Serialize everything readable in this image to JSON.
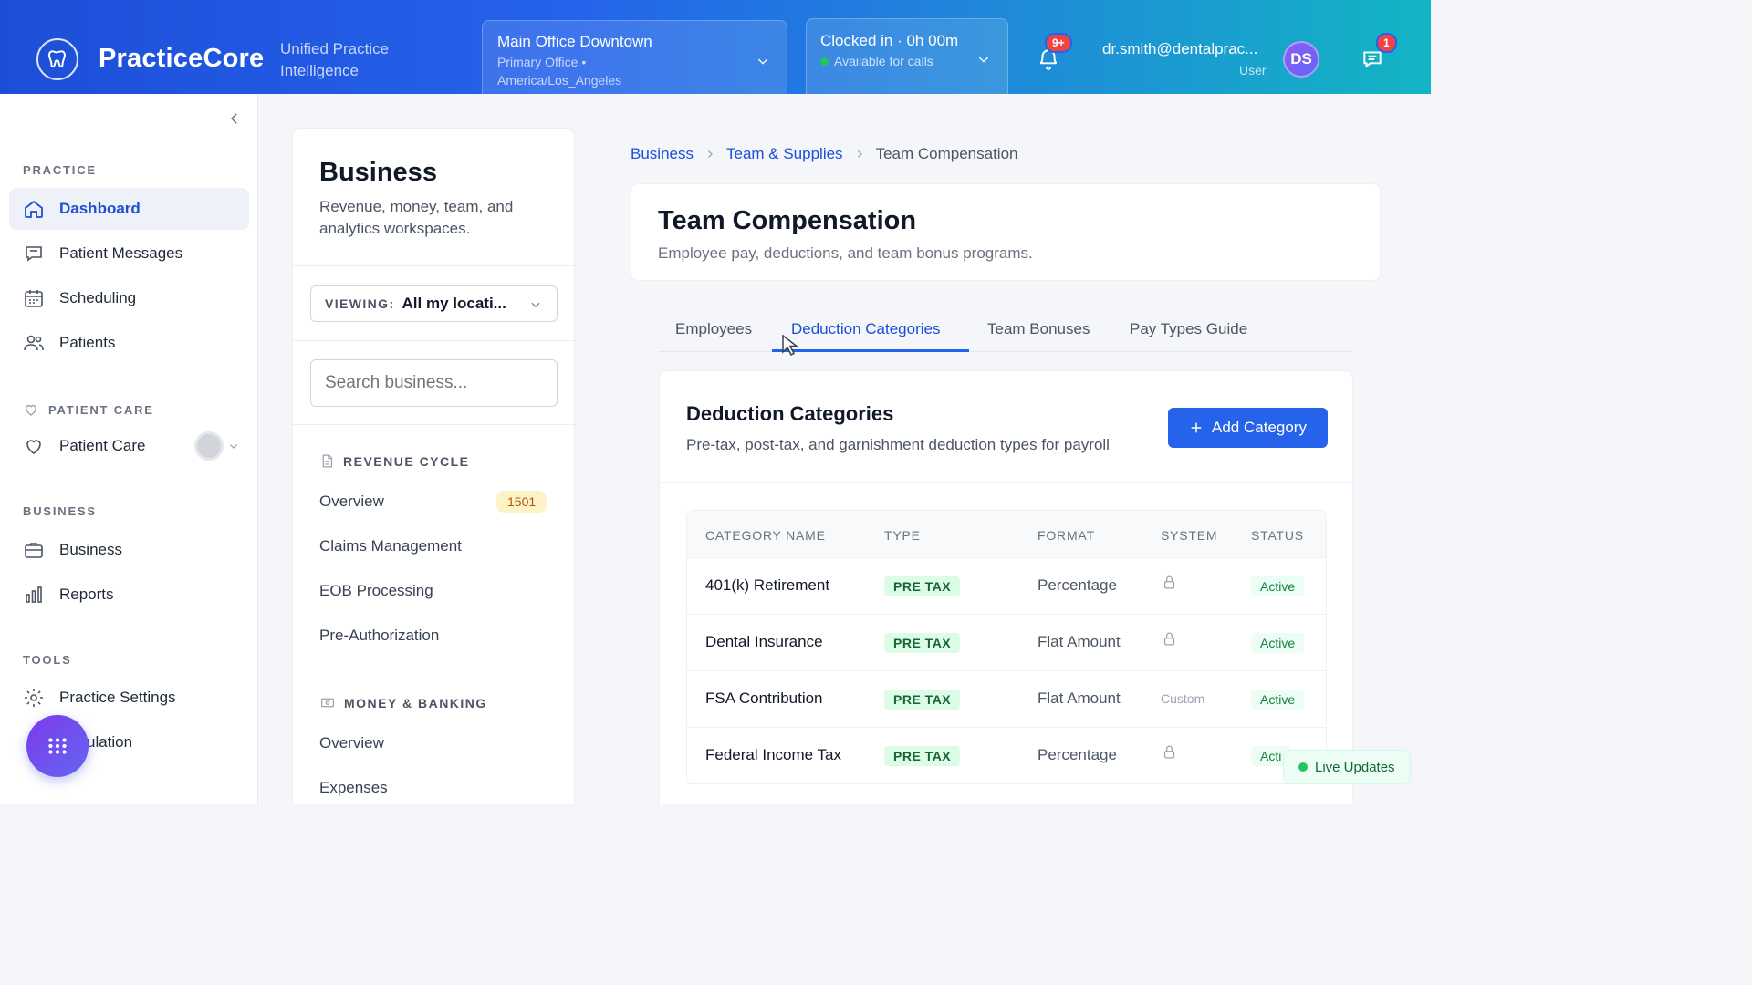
{
  "header": {
    "brand": "PracticeCore",
    "tagline": "Unified Practice Intelligence",
    "location": {
      "title": "Main Office Downtown",
      "subtitle": "Primary Office • America/Los_Angeles"
    },
    "clock": {
      "title": "Clocked in · 0h 00m",
      "status": "Available for calls"
    },
    "notifications_badge": "9+",
    "user_email": "dr.smith@dentalprac...",
    "user_role": "User",
    "avatar_initials": "DS",
    "messages_badge": "1"
  },
  "sidebar": {
    "sections": {
      "practice": "PRACTICE",
      "patient_care": "PATIENT CARE",
      "business": "BUSINESS",
      "tools": "TOOLS"
    },
    "items": {
      "dashboard": "Dashboard",
      "patient_messages": "Patient Messages",
      "scheduling": "Scheduling",
      "patients": "Patients",
      "patient_care": "Patient Care",
      "business": "Business",
      "reports": "Reports",
      "practice_settings": "Practice Settings",
      "simulation": "ulation"
    }
  },
  "business_panel": {
    "title": "Business",
    "description": "Revenue, money, team, and analytics workspaces.",
    "viewing_label": "VIEWING:",
    "viewing_value": "All my locati...",
    "search_placeholder": "Search business...",
    "revenue_cycle": {
      "heading": "REVENUE CYCLE",
      "items": [
        "Overview",
        "Claims Management",
        "EOB Processing",
        "Pre-Authorization"
      ],
      "overview_count": "1501"
    },
    "money_banking": {
      "heading": "MONEY & BANKING",
      "items": [
        "Overview",
        "Expenses"
      ]
    }
  },
  "breadcrumb": {
    "root": "Business",
    "parent": "Team & Supplies",
    "current": "Team Compensation"
  },
  "page": {
    "title": "Team Compensation",
    "subtitle": "Employee pay, deductions, and team bonus programs."
  },
  "tabs": [
    "Employees",
    "Deduction Categories",
    "Team Bonuses",
    "Pay Types Guide"
  ],
  "content": {
    "title": "Deduction Categories",
    "subtitle": "Pre-tax, post-tax, and garnishment deduction types for payroll",
    "add_button": "Add Category",
    "columns": [
      "CATEGORY NAME",
      "TYPE",
      "FORMAT",
      "SYSTEM",
      "STATUS"
    ],
    "rows": [
      {
        "name": "401(k) Retirement",
        "type": "PRE TAX",
        "format": "Percentage",
        "system": "lock-icon",
        "status": "Active"
      },
      {
        "name": "Dental Insurance",
        "type": "PRE TAX",
        "format": "Flat Amount",
        "system": "lock-icon",
        "status": "Active"
      },
      {
        "name": "FSA Contribution",
        "type": "PRE TAX",
        "format": "Flat Amount",
        "system": "Custom",
        "status": "Active"
      },
      {
        "name": "Federal Income Tax",
        "type": "PRE TAX",
        "format": "Percentage",
        "system": "lock-icon",
        "status": "Acti"
      }
    ]
  },
  "live_updates": "Live Updates",
  "colors": {
    "accent": "#2563eb",
    "success": "#22c55e",
    "badge": "#ef4444",
    "fab": "#7c3aed"
  }
}
